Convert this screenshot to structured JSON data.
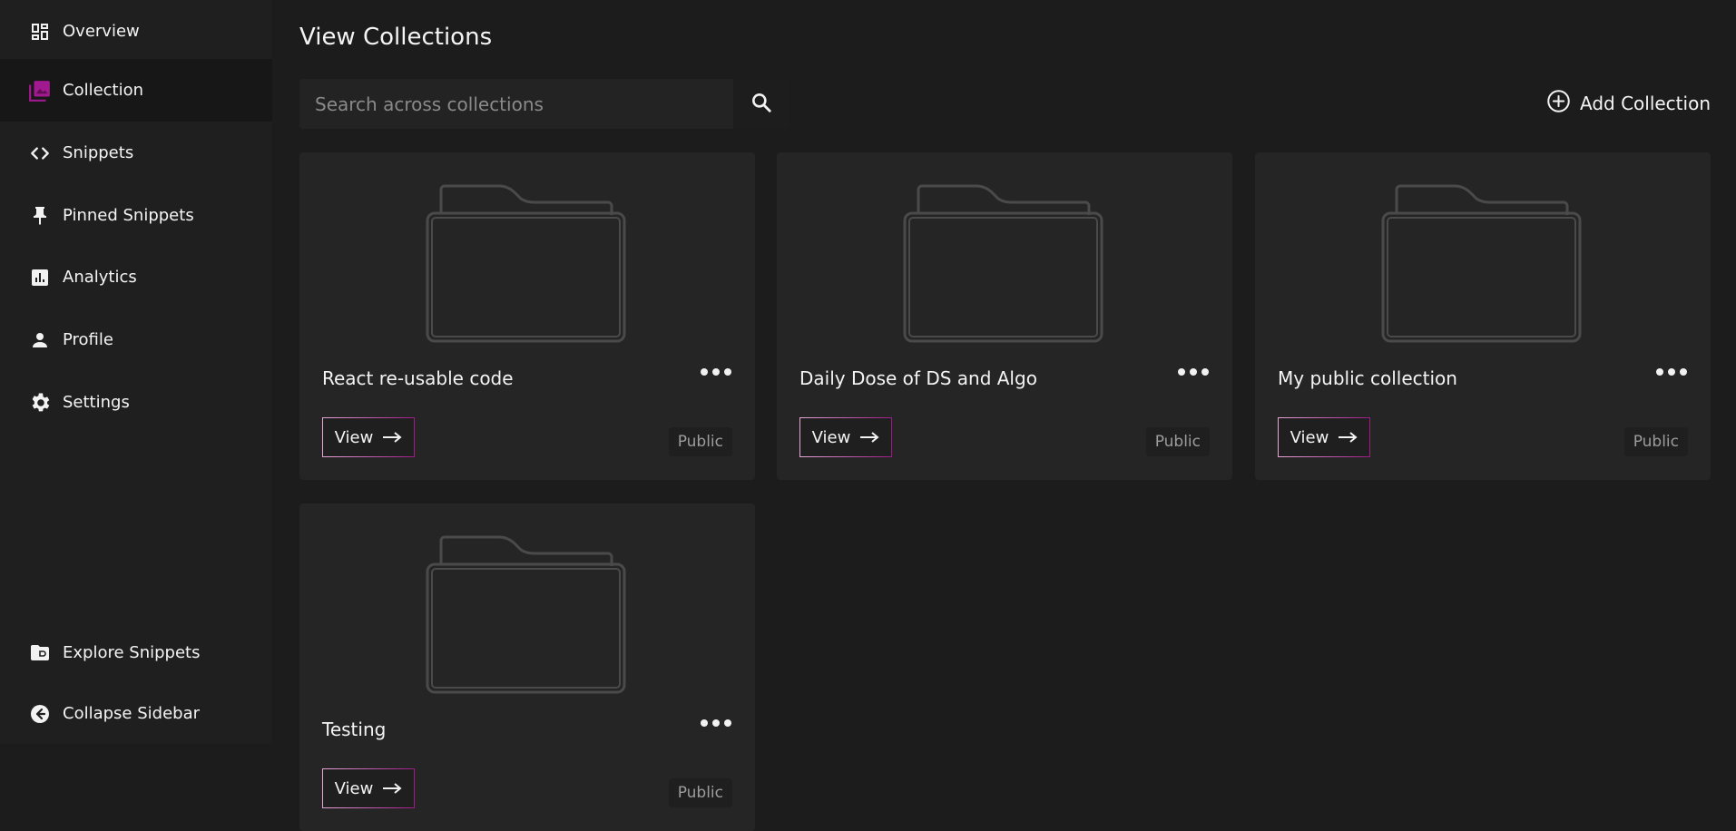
{
  "sidebar": {
    "items": [
      {
        "label": "Overview",
        "icon": "dashboard-icon"
      },
      {
        "label": "Collection",
        "icon": "collection-icon",
        "active": true
      },
      {
        "label": "Snippets",
        "icon": "code-icon"
      },
      {
        "label": "Pinned Snippets",
        "icon": "pin-icon"
      },
      {
        "label": "Analytics",
        "icon": "analytics-icon"
      },
      {
        "label": "Profile",
        "icon": "person-icon"
      },
      {
        "label": "Settings",
        "icon": "gear-icon"
      }
    ],
    "bottom": [
      {
        "label": "Explore Snippets",
        "icon": "folder-shared-icon"
      },
      {
        "label": "Collapse Sidebar",
        "icon": "collapse-icon"
      }
    ],
    "accent_color": "#a3198f"
  },
  "main": {
    "title": "View Collections",
    "search": {
      "placeholder": "Search across collections",
      "value": ""
    },
    "add_collection_label": "Add Collection",
    "collections": [
      {
        "name": "React re-usable code",
        "view_label": "View",
        "visibility": "Public"
      },
      {
        "name": "Daily Dose of DS and Algo",
        "view_label": "View",
        "visibility": "Public"
      },
      {
        "name": "My public collection",
        "view_label": "View",
        "visibility": "Public"
      },
      {
        "name": "Testing",
        "view_label": "View",
        "visibility": "Public"
      }
    ]
  }
}
